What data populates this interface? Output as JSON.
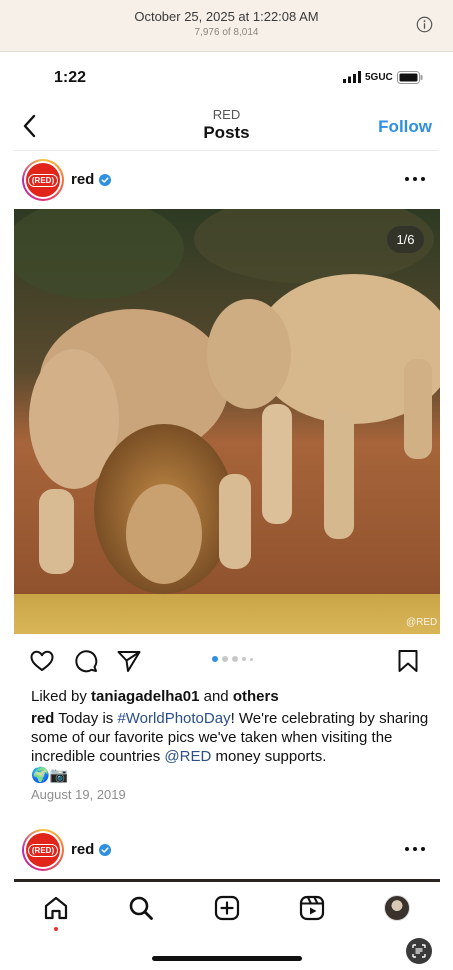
{
  "photos_header": {
    "date": "October 25, 2025 at 1:22:08 AM",
    "count": "7,976 of 8,014"
  },
  "status_bar": {
    "time": "1:22",
    "network": "5GUC"
  },
  "nav": {
    "subtitle": "RED",
    "title": "Posts",
    "follow": "Follow"
  },
  "post": {
    "username": "red",
    "avatar_text": "(RED)",
    "counter": "1/6",
    "watermark": "@RED",
    "liked_by_prefix": "Liked by",
    "liked_by_user": "taniagadelha01",
    "liked_by_and": "and",
    "liked_by_others": "others",
    "caption_user": "red",
    "caption_part1": "Today is",
    "caption_hashtag": "#WorldPhotoDay",
    "caption_part2": "! We're celebrating by sharing some of our favorite pics we've taken when visiting the incredible countries",
    "caption_mention": "@RED",
    "caption_part3": "money supports.",
    "caption_emoji": "🌍📷",
    "date": "August 19, 2019",
    "carousel_active_index": 1,
    "carousel_total": 6
  },
  "second_post": {
    "username": "red",
    "avatar_text": "(RED)"
  },
  "icons": {
    "info": "info-icon",
    "back": "chevron-left-icon",
    "verified": "verified-badge-icon",
    "more": "more-horizontal-icon",
    "like": "heart-icon",
    "comment": "comment-icon",
    "share": "paper-plane-icon",
    "save": "bookmark-icon",
    "home": "home-icon",
    "search": "search-icon",
    "create": "plus-square-icon",
    "reels": "reels-icon",
    "profile": "profile-avatar"
  },
  "colors": {
    "accent": "#2f8fe0",
    "brand_red": "#e1251b",
    "header_bg": "#f6f0e8"
  }
}
